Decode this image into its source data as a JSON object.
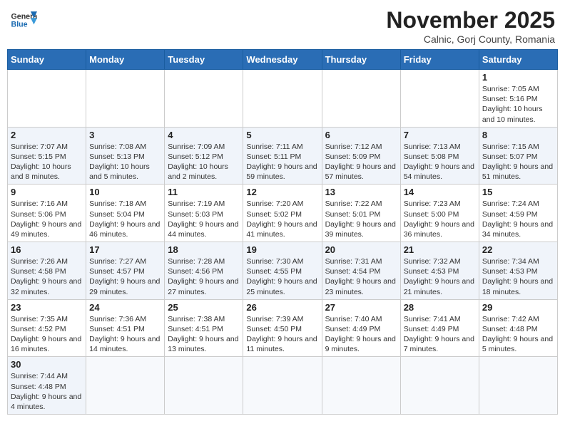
{
  "header": {
    "logo_text_general": "General",
    "logo_text_blue": "Blue",
    "month": "November 2025",
    "location": "Calnic, Gorj County, Romania"
  },
  "weekdays": [
    "Sunday",
    "Monday",
    "Tuesday",
    "Wednesday",
    "Thursday",
    "Friday",
    "Saturday"
  ],
  "weeks": [
    [
      {
        "day": "",
        "info": ""
      },
      {
        "day": "",
        "info": ""
      },
      {
        "day": "",
        "info": ""
      },
      {
        "day": "",
        "info": ""
      },
      {
        "day": "",
        "info": ""
      },
      {
        "day": "",
        "info": ""
      },
      {
        "day": "1",
        "info": "Sunrise: 7:05 AM\nSunset: 5:16 PM\nDaylight: 10 hours and 10 minutes."
      }
    ],
    [
      {
        "day": "2",
        "info": "Sunrise: 7:07 AM\nSunset: 5:15 PM\nDaylight: 10 hours and 8 minutes."
      },
      {
        "day": "3",
        "info": "Sunrise: 7:08 AM\nSunset: 5:13 PM\nDaylight: 10 hours and 5 minutes."
      },
      {
        "day": "4",
        "info": "Sunrise: 7:09 AM\nSunset: 5:12 PM\nDaylight: 10 hours and 2 minutes."
      },
      {
        "day": "5",
        "info": "Sunrise: 7:11 AM\nSunset: 5:11 PM\nDaylight: 9 hours and 59 minutes."
      },
      {
        "day": "6",
        "info": "Sunrise: 7:12 AM\nSunset: 5:09 PM\nDaylight: 9 hours and 57 minutes."
      },
      {
        "day": "7",
        "info": "Sunrise: 7:13 AM\nSunset: 5:08 PM\nDaylight: 9 hours and 54 minutes."
      },
      {
        "day": "8",
        "info": "Sunrise: 7:15 AM\nSunset: 5:07 PM\nDaylight: 9 hours and 51 minutes."
      }
    ],
    [
      {
        "day": "9",
        "info": "Sunrise: 7:16 AM\nSunset: 5:06 PM\nDaylight: 9 hours and 49 minutes."
      },
      {
        "day": "10",
        "info": "Sunrise: 7:18 AM\nSunset: 5:04 PM\nDaylight: 9 hours and 46 minutes."
      },
      {
        "day": "11",
        "info": "Sunrise: 7:19 AM\nSunset: 5:03 PM\nDaylight: 9 hours and 44 minutes."
      },
      {
        "day": "12",
        "info": "Sunrise: 7:20 AM\nSunset: 5:02 PM\nDaylight: 9 hours and 41 minutes."
      },
      {
        "day": "13",
        "info": "Sunrise: 7:22 AM\nSunset: 5:01 PM\nDaylight: 9 hours and 39 minutes."
      },
      {
        "day": "14",
        "info": "Sunrise: 7:23 AM\nSunset: 5:00 PM\nDaylight: 9 hours and 36 minutes."
      },
      {
        "day": "15",
        "info": "Sunrise: 7:24 AM\nSunset: 4:59 PM\nDaylight: 9 hours and 34 minutes."
      }
    ],
    [
      {
        "day": "16",
        "info": "Sunrise: 7:26 AM\nSunset: 4:58 PM\nDaylight: 9 hours and 32 minutes."
      },
      {
        "day": "17",
        "info": "Sunrise: 7:27 AM\nSunset: 4:57 PM\nDaylight: 9 hours and 29 minutes."
      },
      {
        "day": "18",
        "info": "Sunrise: 7:28 AM\nSunset: 4:56 PM\nDaylight: 9 hours and 27 minutes."
      },
      {
        "day": "19",
        "info": "Sunrise: 7:30 AM\nSunset: 4:55 PM\nDaylight: 9 hours and 25 minutes."
      },
      {
        "day": "20",
        "info": "Sunrise: 7:31 AM\nSunset: 4:54 PM\nDaylight: 9 hours and 23 minutes."
      },
      {
        "day": "21",
        "info": "Sunrise: 7:32 AM\nSunset: 4:53 PM\nDaylight: 9 hours and 21 minutes."
      },
      {
        "day": "22",
        "info": "Sunrise: 7:34 AM\nSunset: 4:53 PM\nDaylight: 9 hours and 18 minutes."
      }
    ],
    [
      {
        "day": "23",
        "info": "Sunrise: 7:35 AM\nSunset: 4:52 PM\nDaylight: 9 hours and 16 minutes."
      },
      {
        "day": "24",
        "info": "Sunrise: 7:36 AM\nSunset: 4:51 PM\nDaylight: 9 hours and 14 minutes."
      },
      {
        "day": "25",
        "info": "Sunrise: 7:38 AM\nSunset: 4:51 PM\nDaylight: 9 hours and 13 minutes."
      },
      {
        "day": "26",
        "info": "Sunrise: 7:39 AM\nSunset: 4:50 PM\nDaylight: 9 hours and 11 minutes."
      },
      {
        "day": "27",
        "info": "Sunrise: 7:40 AM\nSunset: 4:49 PM\nDaylight: 9 hours and 9 minutes."
      },
      {
        "day": "28",
        "info": "Sunrise: 7:41 AM\nSunset: 4:49 PM\nDaylight: 9 hours and 7 minutes."
      },
      {
        "day": "29",
        "info": "Sunrise: 7:42 AM\nSunset: 4:48 PM\nDaylight: 9 hours and 5 minutes."
      }
    ],
    [
      {
        "day": "30",
        "info": "Sunrise: 7:44 AM\nSunset: 4:48 PM\nDaylight: 9 hours and 4 minutes."
      },
      {
        "day": "",
        "info": ""
      },
      {
        "day": "",
        "info": ""
      },
      {
        "day": "",
        "info": ""
      },
      {
        "day": "",
        "info": ""
      },
      {
        "day": "",
        "info": ""
      },
      {
        "day": "",
        "info": ""
      }
    ]
  ]
}
